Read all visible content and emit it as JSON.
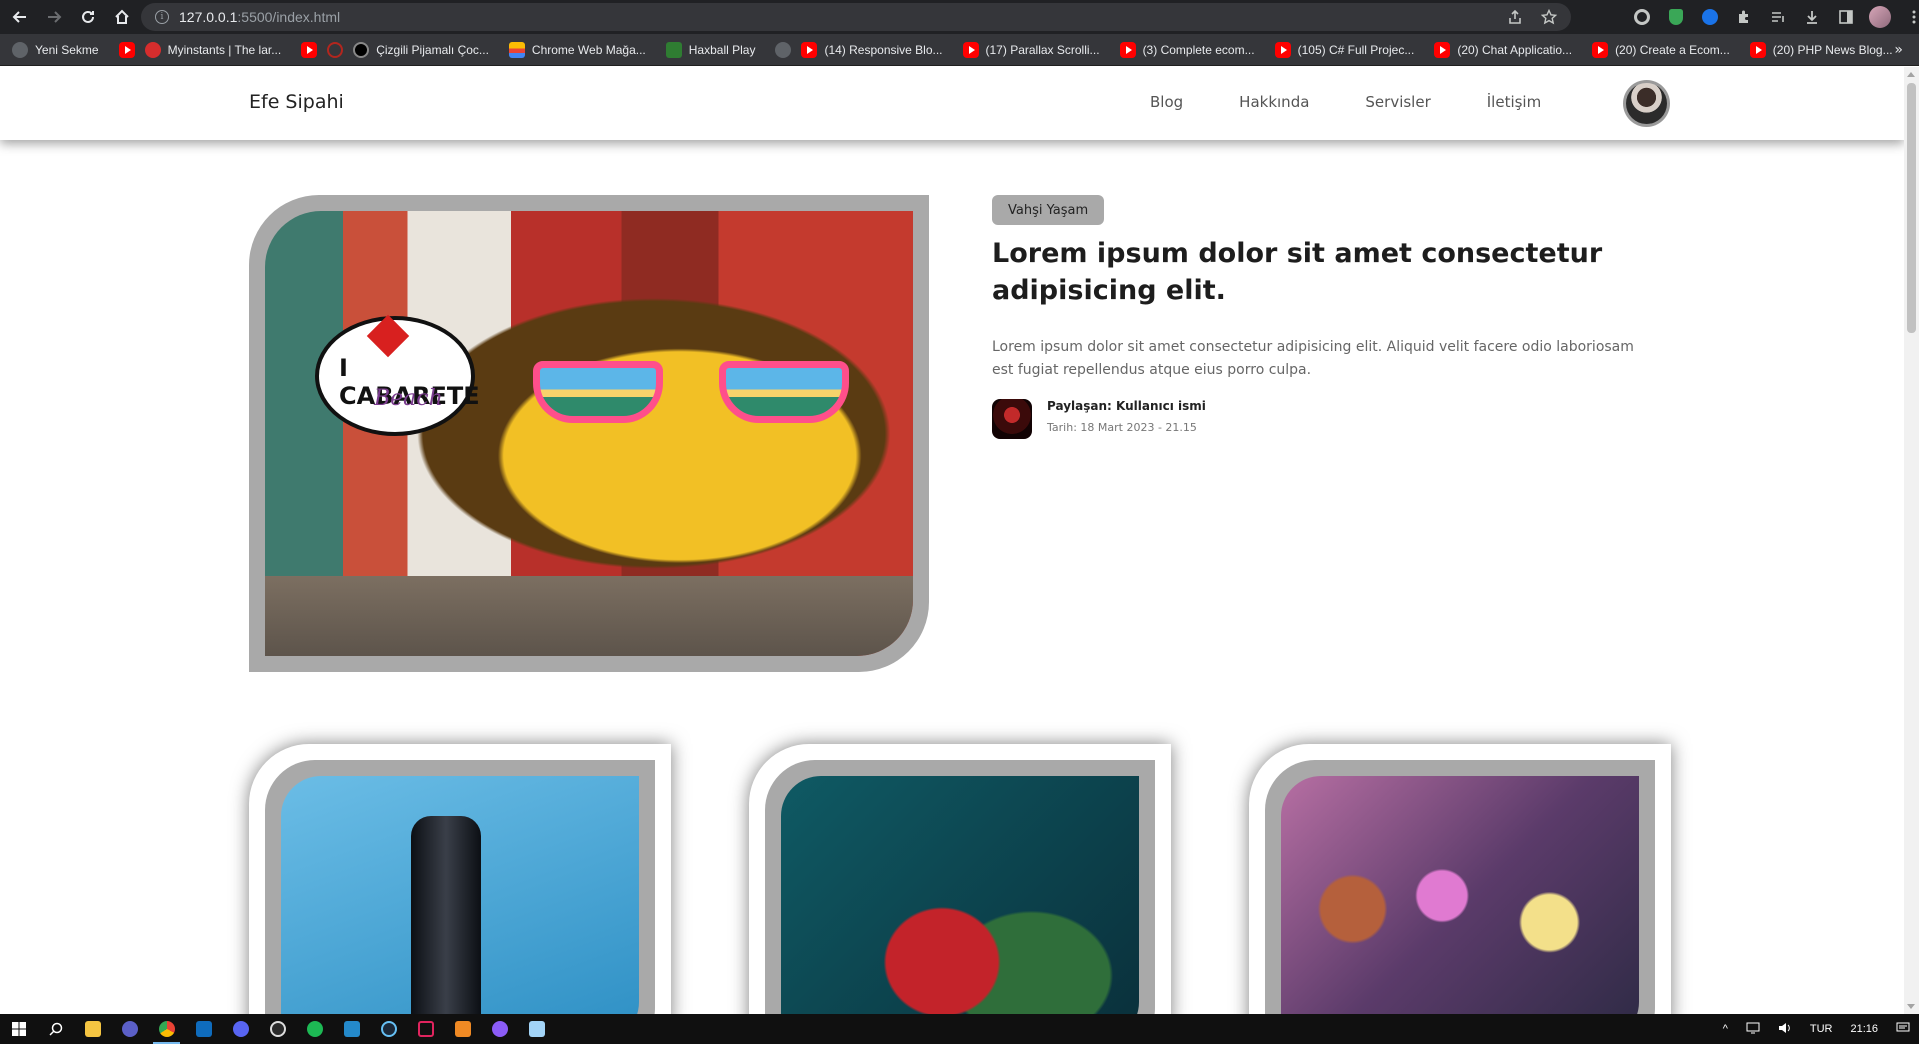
{
  "browser": {
    "url_host": "127.0.0.1",
    "url_path": ":5500/index.html",
    "bookmarks": [
      {
        "label": "Yeni Sekme",
        "icon": "globe"
      },
      {
        "label": "",
        "icon": "yt"
      },
      {
        "label": "Myinstants | The lar...",
        "icon": "red"
      },
      {
        "label": "",
        "icon": "yt"
      },
      {
        "label": "",
        "icon": "ring"
      },
      {
        "label": "Çizgili Pijamalı Çoc...",
        "icon": "dark"
      },
      {
        "label": "Chrome Web Mağa...",
        "icon": "store"
      },
      {
        "label": "Haxball Play",
        "icon": "hax"
      },
      {
        "label": "",
        "icon": "globe"
      },
      {
        "label": "(14) Responsive Blo...",
        "icon": "yt"
      },
      {
        "label": "(17) Parallax Scrolli...",
        "icon": "yt"
      },
      {
        "label": "(3) Complete ecom...",
        "icon": "yt"
      },
      {
        "label": "(105) C# Full Projec...",
        "icon": "yt"
      },
      {
        "label": "(20) Chat Applicatio...",
        "icon": "yt"
      },
      {
        "label": "(20) Create a Ecom...",
        "icon": "yt"
      },
      {
        "label": "(20) PHP News Blog...",
        "icon": "yt"
      }
    ]
  },
  "site": {
    "logo": "Efe Sipahi",
    "nav": [
      "Blog",
      "Hakkında",
      "Servisler",
      "İletişim"
    ]
  },
  "hero": {
    "category": "Vahşi Yaşam",
    "title": "Lorem ipsum dolor sit amet consectetur adipisicing elit.",
    "excerpt": "Lorem ipsum dolor sit amet consectetur adipisicing elit. Aliquid velit facere odio laboriosam est fugiat repellendus atque eius porro culpa.",
    "author": "Paylaşan: Kullanıcı ismi",
    "date": "Tarih: 18 Mart 2023 - 21.15",
    "mural_text": "I CABARETE",
    "mural_script": "Beach"
  },
  "taskbar": {
    "language": "TUR",
    "time": "21:16"
  }
}
